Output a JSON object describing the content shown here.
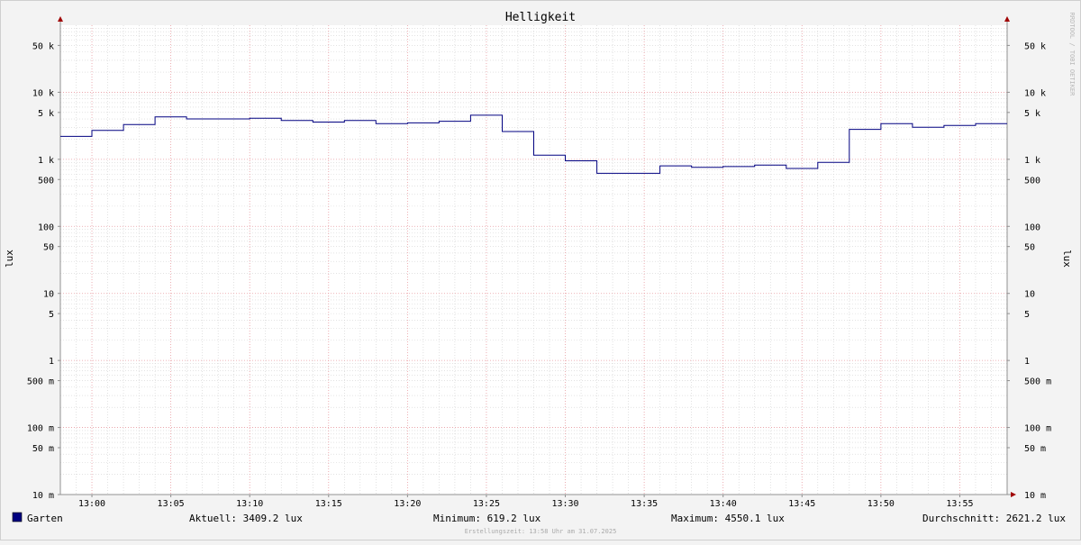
{
  "chart_data": {
    "type": "line",
    "title": "Helligkeit",
    "ylabel_left": "lux",
    "ylabel_right": "lux",
    "watermark": "RRDTOOL / TOBI OETIKER",
    "yscale": "log",
    "ylim": [
      0.01,
      100000
    ],
    "y_ticks": [
      {
        "v": 0.01,
        "label": "10 m"
      },
      {
        "v": 0.05,
        "label": "50 m"
      },
      {
        "v": 0.1,
        "label": "100 m"
      },
      {
        "v": 0.5,
        "label": "500 m"
      },
      {
        "v": 1,
        "label": "1"
      },
      {
        "v": 5,
        "label": "5"
      },
      {
        "v": 10,
        "label": "10"
      },
      {
        "v": 50,
        "label": "50"
      },
      {
        "v": 100,
        "label": "100"
      },
      {
        "v": 500,
        "label": "500"
      },
      {
        "v": 1000,
        "label": "1 k"
      },
      {
        "v": 5000,
        "label": "5 k"
      },
      {
        "v": 10000,
        "label": "10 k"
      },
      {
        "v": 50000,
        "label": "50 k"
      }
    ],
    "xlim": [
      "12:58",
      "13:58"
    ],
    "x_ticks": [
      "13:00",
      "13:05",
      "13:10",
      "13:15",
      "13:20",
      "13:25",
      "13:30",
      "13:35",
      "13:40",
      "13:45",
      "13:50",
      "13:55"
    ],
    "series": [
      {
        "name": "Garten",
        "color": "#000080",
        "steps": [
          {
            "from": "12:58",
            "to": "13:00",
            "value": 2200
          },
          {
            "from": "13:00",
            "to": "13:02",
            "value": 2700
          },
          {
            "from": "13:02",
            "to": "13:04",
            "value": 3300
          },
          {
            "from": "13:04",
            "to": "13:06",
            "value": 4300
          },
          {
            "from": "13:06",
            "to": "13:10",
            "value": 4000
          },
          {
            "from": "13:10",
            "to": "13:12",
            "value": 4100
          },
          {
            "from": "13:12",
            "to": "13:14",
            "value": 3800
          },
          {
            "from": "13:14",
            "to": "13:16",
            "value": 3600
          },
          {
            "from": "13:16",
            "to": "13:18",
            "value": 3800
          },
          {
            "from": "13:18",
            "to": "13:20",
            "value": 3400
          },
          {
            "from": "13:20",
            "to": "13:22",
            "value": 3500
          },
          {
            "from": "13:22",
            "to": "13:24",
            "value": 3700
          },
          {
            "from": "13:24",
            "to": "13:26",
            "value": 4550
          },
          {
            "from": "13:26",
            "to": "13:28",
            "value": 2600
          },
          {
            "from": "13:28",
            "to": "13:30",
            "value": 1150
          },
          {
            "from": "13:30",
            "to": "13:32",
            "value": 950
          },
          {
            "from": "13:32",
            "to": "13:36",
            "value": 619
          },
          {
            "from": "13:36",
            "to": "13:38",
            "value": 800
          },
          {
            "from": "13:38",
            "to": "13:40",
            "value": 760
          },
          {
            "from": "13:40",
            "to": "13:42",
            "value": 780
          },
          {
            "from": "13:42",
            "to": "13:44",
            "value": 820
          },
          {
            "from": "13:44",
            "to": "13:46",
            "value": 730
          },
          {
            "from": "13:46",
            "to": "13:48",
            "value": 900
          },
          {
            "from": "13:48",
            "to": "13:50",
            "value": 2800
          },
          {
            "from": "13:50",
            "to": "13:52",
            "value": 3400
          },
          {
            "from": "13:52",
            "to": "13:54",
            "value": 3000
          },
          {
            "from": "13:54",
            "to": "13:56",
            "value": 3200
          },
          {
            "from": "13:56",
            "to": "13:58",
            "value": 3409
          }
        ]
      }
    ],
    "grid": true,
    "legend": {
      "name": "Garten",
      "color": "#000080",
      "stats": [
        {
          "key": "current",
          "text": "Aktuell: 3409.2 lux"
        },
        {
          "key": "minimum",
          "text": "Minimum: 619.2 lux"
        },
        {
          "key": "maximum",
          "text": "Maximum: 4550.1 lux"
        },
        {
          "key": "average",
          "text": "Durchschnitt: 2621.2 lux"
        }
      ]
    },
    "footer": "Erstellungszeit: 13:58 Uhr am 31.07.2025"
  }
}
